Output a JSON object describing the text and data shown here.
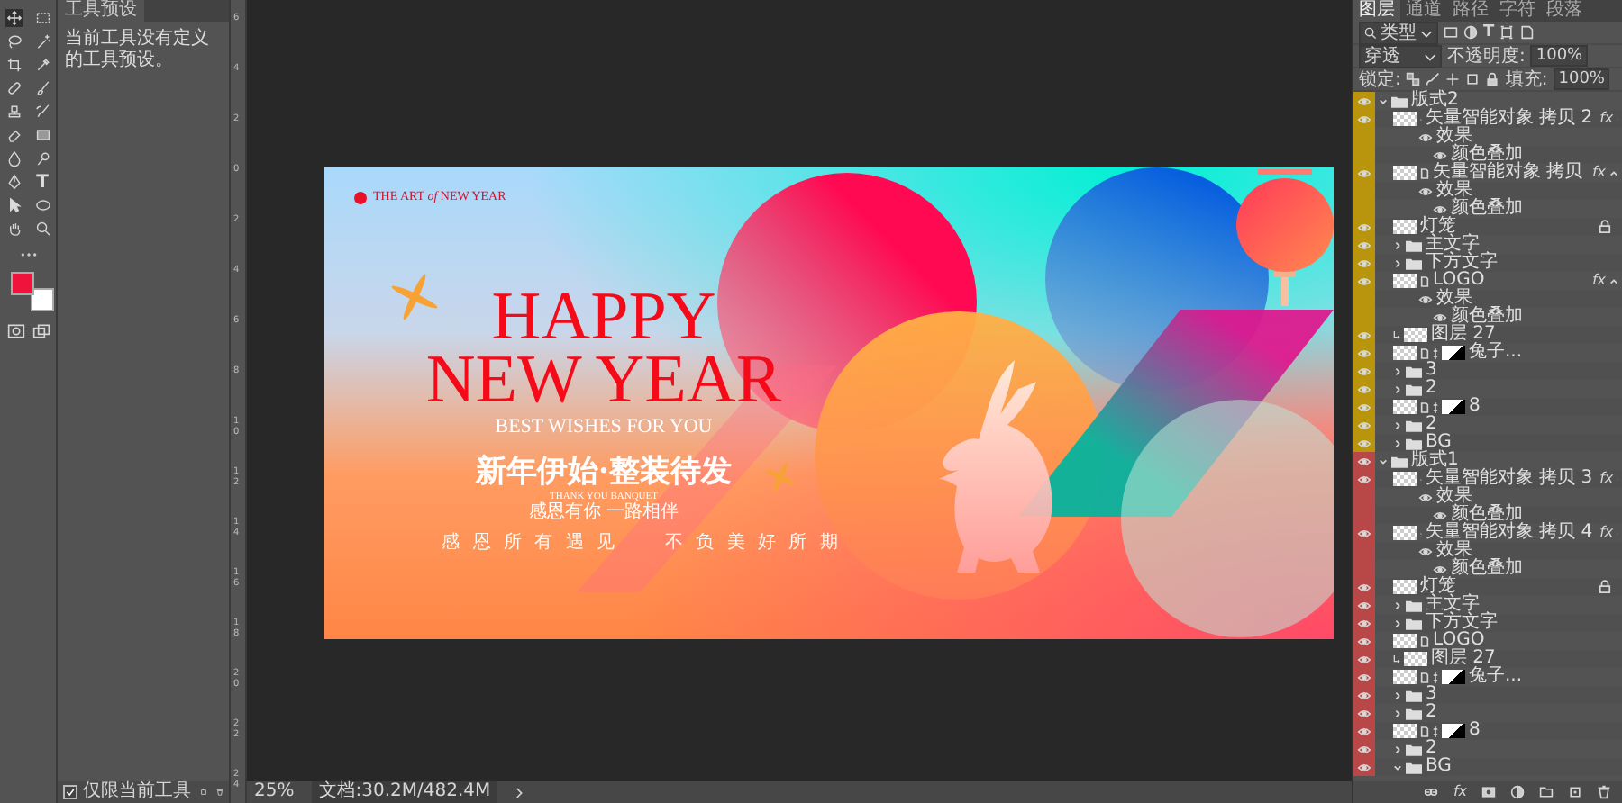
{
  "toolbar": {
    "tools": [
      {
        "kind": "move",
        "selected": true
      },
      {
        "kind": "marquee",
        "selected": false
      },
      {
        "kind": "lasso",
        "selected": false
      },
      {
        "kind": "wand",
        "selected": false
      },
      {
        "kind": "crop",
        "selected": false
      },
      {
        "kind": "eyedropper",
        "selected": false
      },
      {
        "kind": "healing",
        "selected": false
      },
      {
        "kind": "brush",
        "selected": false
      },
      {
        "kind": "stamp",
        "selected": false
      },
      {
        "kind": "history",
        "selected": false
      },
      {
        "kind": "eraser",
        "selected": false
      },
      {
        "kind": "gradient",
        "selected": false
      },
      {
        "kind": "blur",
        "selected": false
      },
      {
        "kind": "dodge",
        "selected": false
      },
      {
        "kind": "pen",
        "selected": false
      },
      {
        "kind": "type",
        "glyph": "T",
        "selected": false
      },
      {
        "kind": "pointer",
        "selected": false
      },
      {
        "kind": "ellipse",
        "selected": false
      },
      {
        "kind": "hand",
        "selected": false
      },
      {
        "kind": "zoom",
        "selected": false
      }
    ],
    "foreground": {
      "color": "#f0143c"
    },
    "background": {
      "color": "#ffffff"
    }
  },
  "presets_panel": {
    "tab": "工具预设",
    "message": "当前工具没有定义的工具预设。",
    "current_only": {
      "label": "仅限当前工具",
      "checked": true
    }
  },
  "ruler": {
    "labels": [
      "6",
      "4",
      "2",
      "0",
      "2",
      "4",
      "6",
      "8",
      "10",
      "12",
      "14",
      "16",
      "18",
      "20",
      "22",
      "24"
    ]
  },
  "poster": {
    "logo": "THE ART *of* NEW YEAR",
    "headline": [
      "HAPPY",
      "NEW YEAR"
    ],
    "subtitle": "BEST WISHES FOR YOU",
    "slogan": "新年伊始·整装待发",
    "small_caption": "THANK YOU BANQUET",
    "caption": "感恩有你 一路相伴",
    "footer": [
      "感 恩 所 有 遇 见",
      "不 负 美 好 所 期"
    ]
  },
  "status_bar": {
    "zoom": "25%",
    "document": "文档:30.2M/482.4M"
  },
  "layers_panel": {
    "tabs": [
      {
        "label": "图层",
        "selected": true
      },
      {
        "label": "通道",
        "selected": false
      },
      {
        "label": "路径",
        "selected": false
      },
      {
        "label": "字符",
        "selected": false
      },
      {
        "label": "段落",
        "selected": false
      }
    ],
    "filter": {
      "label": "类型",
      "type_glyph": "T"
    },
    "blend_mode": "穿透",
    "opacity_label": "不透明度:",
    "opacity": "100%",
    "lock_label": "锁定:",
    "fill_label": "填充:",
    "fill": "100%",
    "layers": [
      {
        "kind": "group",
        "name": "版式2",
        "expanded": true,
        "color": "#b8950c",
        "children": [
          {
            "kind": "smart",
            "name": "矢量智能对象 拷贝 2",
            "fx": "fx",
            "effects_label": "效果",
            "effects": [
              "颜色叠加"
            ]
          },
          {
            "kind": "smart",
            "name": "矢量智能对象 拷贝",
            "fx": "fx",
            "effects_label": "效果",
            "effects": [
              "颜色叠加"
            ]
          },
          {
            "kind": "pixel",
            "name": "灯笼",
            "locked": true
          },
          {
            "kind": "group",
            "name": "主文字",
            "expanded": false
          },
          {
            "kind": "group",
            "name": "下方文字",
            "expanded": false
          },
          {
            "kind": "smart",
            "name": "LOGO",
            "fx": "fx",
            "effects_label": "效果",
            "effects": [
              "颜色叠加"
            ]
          },
          {
            "kind": "pixel",
            "name": "图层 27",
            "clipped": true
          },
          {
            "kind": "smart",
            "name": "兔子...",
            "mask": true
          },
          {
            "kind": "group",
            "name": "3",
            "expanded": false
          },
          {
            "kind": "group",
            "name": "2",
            "expanded": false
          },
          {
            "kind": "smart",
            "name": "8",
            "mask": true
          },
          {
            "kind": "group",
            "name": "2",
            "expanded": false
          },
          {
            "kind": "group",
            "name": "BG",
            "expanded": false
          }
        ]
      },
      {
        "kind": "group",
        "name": "版式1",
        "expanded": true,
        "color": "#b84848",
        "children": [
          {
            "kind": "smart",
            "name": "矢量智能对象 拷贝 3",
            "fx": "fx",
            "effects_label": "效果",
            "effects": [
              "颜色叠加"
            ]
          },
          {
            "kind": "smart",
            "name": "矢量智能对象 拷贝 4",
            "fx": "fx",
            "effects_label": "效果",
            "effects": [
              "颜色叠加"
            ]
          },
          {
            "kind": "pixel",
            "name": "灯笼",
            "locked": true
          },
          {
            "kind": "group",
            "name": "主文字",
            "expanded": false
          },
          {
            "kind": "group",
            "name": "下方文字",
            "expanded": false
          },
          {
            "kind": "smart",
            "name": "LOGO"
          },
          {
            "kind": "pixel",
            "name": "图层 27",
            "clipped": true
          },
          {
            "kind": "smart",
            "name": "兔子...",
            "mask": true
          },
          {
            "kind": "group",
            "name": "3",
            "expanded": false
          },
          {
            "kind": "group",
            "name": "2",
            "expanded": false
          },
          {
            "kind": "smart",
            "name": "8",
            "mask": true
          },
          {
            "kind": "group",
            "name": "2",
            "expanded": false
          },
          {
            "kind": "group",
            "name": "BG",
            "expanded": true
          }
        ]
      }
    ],
    "footer_fx": "fx"
  }
}
